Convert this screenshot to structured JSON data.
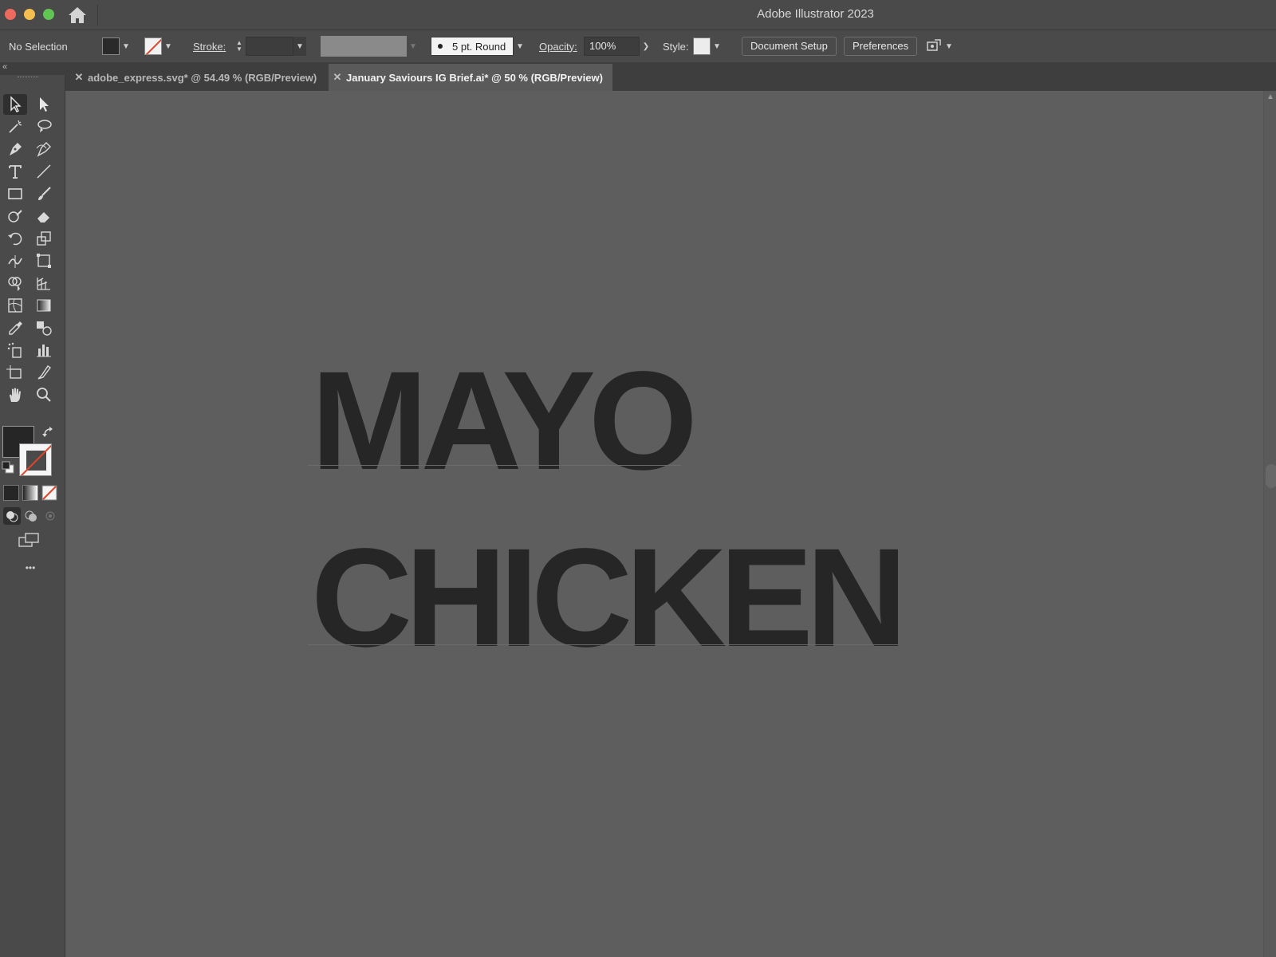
{
  "window": {
    "title": "Adobe Illustrator 2023"
  },
  "control_bar": {
    "selection_label": "No Selection",
    "stroke_label": "Stroke:",
    "brush_label": "5 pt. Round",
    "opacity_label": "Opacity:",
    "opacity_value": "100%",
    "style_label": "Style:",
    "document_setup_label": "Document Setup",
    "preferences_label": "Preferences"
  },
  "tabs": [
    {
      "label": "adobe_express.svg* @ 54.49 % (RGB/Preview)",
      "active": false
    },
    {
      "label": "January Saviours IG Brief.ai* @ 50 % (RGB/Preview)",
      "active": true
    }
  ],
  "canvas": {
    "line1": "MAYO",
    "line2": "CHICKEN"
  },
  "toolbar": {
    "more_label": "•••"
  },
  "colors": {
    "fill": "#262626",
    "stroke_none_slash": "#e0452b",
    "canvas_bg": "#5e5e5e",
    "ui_panel": "#4a4a4a"
  }
}
